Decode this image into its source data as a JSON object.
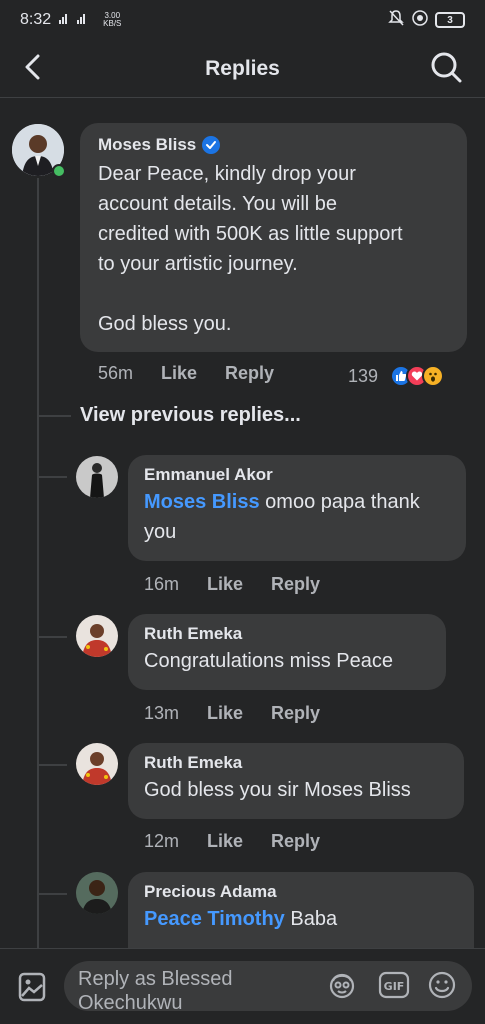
{
  "status_bar": {
    "time": "8:32",
    "net_speed_value": "3.00",
    "net_speed_unit": "KB/S",
    "battery": "3"
  },
  "header": {
    "title": "Replies"
  },
  "main_comment": {
    "author": "Moses Bliss",
    "verified": true,
    "text_lines": [
      "Dear Peace, kindly drop your",
      "account details. You will be",
      "credited with 500K as little support",
      "to your artistic journey."
    ],
    "closing": "God bless you.",
    "time": "56m",
    "like_label": "Like",
    "reply_label": "Reply",
    "reaction_count": "139"
  },
  "view_previous": "View previous replies...",
  "replies": [
    {
      "author": "Emmanuel Akor",
      "tag": "Moses Bliss",
      "text": " omoo papa thank you",
      "time": "16m",
      "like_label": "Like",
      "reply_label": "Reply"
    },
    {
      "author": "Ruth Emeka",
      "text": "Congratulations miss Peace",
      "time": "13m",
      "like_label": "Like",
      "reply_label": "Reply"
    },
    {
      "author": "Ruth Emeka",
      "text": "God bless you sir Moses Bliss",
      "time": "12m",
      "like_label": "Like",
      "reply_label": "Reply"
    },
    {
      "author": "Precious Adama",
      "tag": "Peace Timothy",
      "text": " Baba"
    }
  ],
  "composer": {
    "placeholder": "Reply as Blessed Okechukwu"
  },
  "colors": {
    "background": "#242526",
    "bubble": "#3a3b3c",
    "tag": "#4599ff",
    "online": "#45bd62"
  },
  "icons": [
    "back-arrow-icon",
    "search-icon",
    "verified-icon",
    "like-reaction-icon",
    "love-reaction-icon",
    "wow-reaction-icon",
    "photo-icon",
    "avatar-sticker-icon",
    "gif-icon",
    "emoji-icon"
  ]
}
